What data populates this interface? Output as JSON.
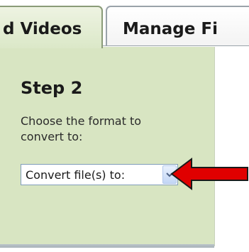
{
  "tabs": [
    {
      "label": "d Videos",
      "active": true
    },
    {
      "label": "Manage Fi",
      "active": false
    }
  ],
  "panel": {
    "step_title": "Step 2",
    "instructions_line1": "Choose the format to",
    "instructions_line2": "convert to:"
  },
  "format_select": {
    "value": "Convert file(s) to:",
    "icon": "chevron-down-icon"
  },
  "annotation": {
    "icon": "red-arrow-icon",
    "color": "#e00000"
  },
  "colors": {
    "panel_bg": "#d8e5c2",
    "select_border": "#7f9db9",
    "arrow_fill": "#e00000"
  }
}
